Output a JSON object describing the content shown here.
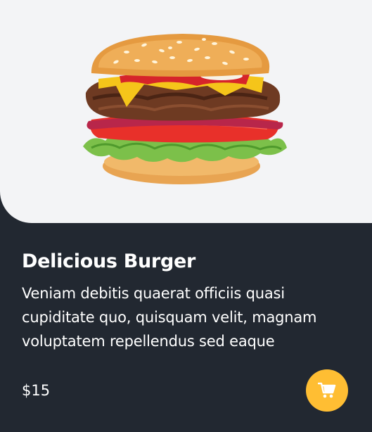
{
  "product": {
    "name": "Delicious Burger",
    "description": "Veniam debitis quaerat officiis quasi cupiditate quo, quisquam velit, magnam voluptatem repellendus sed eaque",
    "price": "$15"
  },
  "cart_button": {
    "icon": "shopping-cart-icon"
  },
  "image": {
    "icon": "burger-image"
  },
  "colors": {
    "card_background": "#222831",
    "image_background": "#f3f4f6",
    "accent": "#ffbe33",
    "text": "#ffffff"
  }
}
